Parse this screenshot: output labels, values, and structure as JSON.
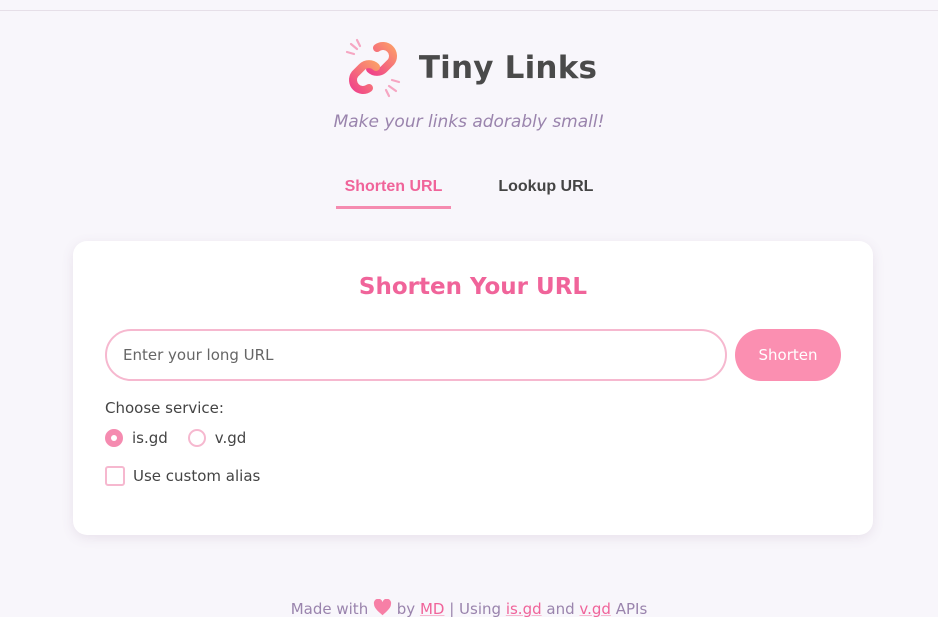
{
  "app": {
    "title": "Tiny Links",
    "subtitle": "Make your links adorably small!"
  },
  "tabs": [
    {
      "label": "Shorten URL",
      "active": true
    },
    {
      "label": "Lookup URL",
      "active": false
    }
  ],
  "card": {
    "title": "Shorten Your URL",
    "url_input": {
      "value": "",
      "placeholder": "Enter your long URL"
    },
    "shorten_label": "Shorten",
    "service_label": "Choose service:",
    "services": [
      {
        "label": "is.gd",
        "selected": true
      },
      {
        "label": "v.gd",
        "selected": false
      }
    ],
    "custom_alias_label": "Use custom alias",
    "custom_alias_checked": false
  },
  "footer": {
    "made_with": "Made with",
    "by": "by",
    "author": "MD",
    "sep": "| Using",
    "api1": "is.gd",
    "and": "and",
    "api2": "v.gd",
    "apis": "APIs"
  },
  "colors": {
    "accent": "#f0649a",
    "button": "#fb8fb1",
    "border": "#f6b8cf",
    "muted_purple": "#9a84ad",
    "background": "#f8f6fb"
  },
  "icons": {
    "logo": "link-chain-icon",
    "heart": "heart-icon"
  }
}
